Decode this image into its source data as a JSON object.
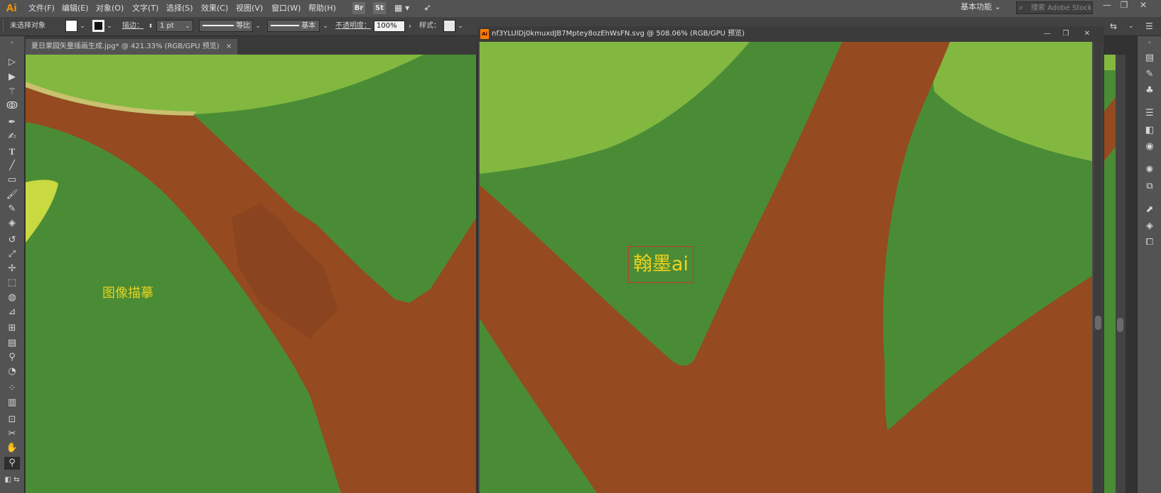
{
  "app": {
    "logo": "Ai"
  },
  "menu": [
    {
      "label": "文件(F)"
    },
    {
      "label": "编辑(E)"
    },
    {
      "label": "对象(O)"
    },
    {
      "label": "文字(T)"
    },
    {
      "label": "选择(S)"
    },
    {
      "label": "效果(C)"
    },
    {
      "label": "视图(V)"
    },
    {
      "label": "窗口(W)"
    },
    {
      "label": "帮助(H)"
    }
  ],
  "app_buttons": {
    "bridge": "Br",
    "stock": "St"
  },
  "workspace": {
    "label": "基本功能"
  },
  "search": {
    "placeholder": "搜索 Adobe Stock"
  },
  "window_controls": {
    "minimize": "—",
    "restore": "❐",
    "close": "✕"
  },
  "control_bar": {
    "selection_status": "未选择对象",
    "stroke_label": "描边：",
    "stroke_weight": "1 pt",
    "profile_label": "等比",
    "brush_label": "基本",
    "opacity_label": "不透明度：",
    "opacity_value": "100%",
    "style_label": "样式："
  },
  "documents": [
    {
      "tab_title": "夏日果园矢量插画生成.jpg* @ 421.33% (RGB/GPU 预览)",
      "close": "×",
      "overlay_text": "图像描摹"
    },
    {
      "window_title": "nf3YLUlDj0kmuxdJB7Mptey8ozEhWsFN.svg  @  508.06%  (RGB/GPU 预览)",
      "overlay_text": "翰墨ai"
    }
  ],
  "tools": [
    "selection-tool",
    "direct-selection-tool",
    "magic-wand-tool",
    "lasso-tool",
    "pen-tool",
    "curvature-tool",
    "type-tool",
    "line-tool",
    "rectangle-tool",
    "paintbrush-tool",
    "shaper-tool",
    "eraser-tool",
    "rotate-tool",
    "scale-tool",
    "puppet-warp-tool",
    "free-transform-tool",
    "shape-builder-tool",
    "perspective-grid-tool",
    "mesh-tool",
    "gradient-tool",
    "eyedropper-tool",
    "blend-tool",
    "symbol-sprayer-tool",
    "column-graph-tool",
    "artboard-tool",
    "slice-tool",
    "hand-tool",
    "zoom-tool"
  ],
  "panels": [
    "libraries-icon",
    "brushes-icon",
    "symbols-icon",
    "align-icon",
    "transparency-icon",
    "appearance-icon",
    "color-guide-icon",
    "asset-export-icon",
    "export-icon",
    "layers-icon",
    "artboards-icon"
  ],
  "colors": {
    "dark_green": "#4a8c36",
    "light_green": "#82b840",
    "trunk_brown": "#954a1f",
    "yellow_leaf": "#c9d940",
    "label_yellow": "#e8d21c"
  }
}
